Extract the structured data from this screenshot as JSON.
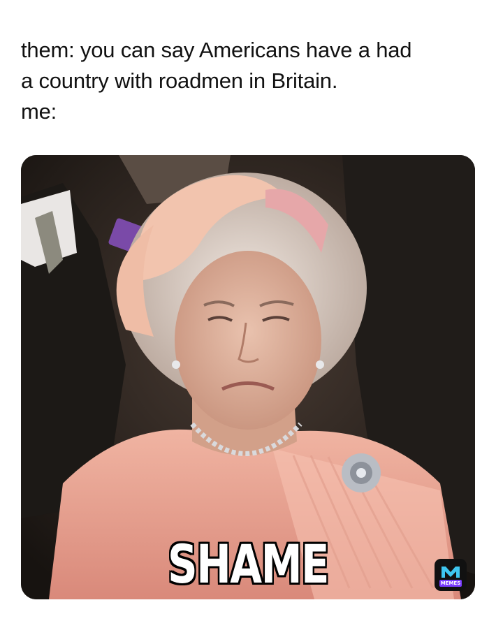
{
  "caption": {
    "line1": "them: you can say Americans have a had",
    "line2": "a country with roadmen in Britain.",
    "line3": "me:"
  },
  "image": {
    "overlay_text": "SHAME",
    "colors": {
      "dress": "#e8a08c",
      "background": "#2a2420",
      "hair": "#d8ccc4"
    }
  },
  "watermark": {
    "icon": "memes-logo-icon",
    "label": "MEMES"
  }
}
